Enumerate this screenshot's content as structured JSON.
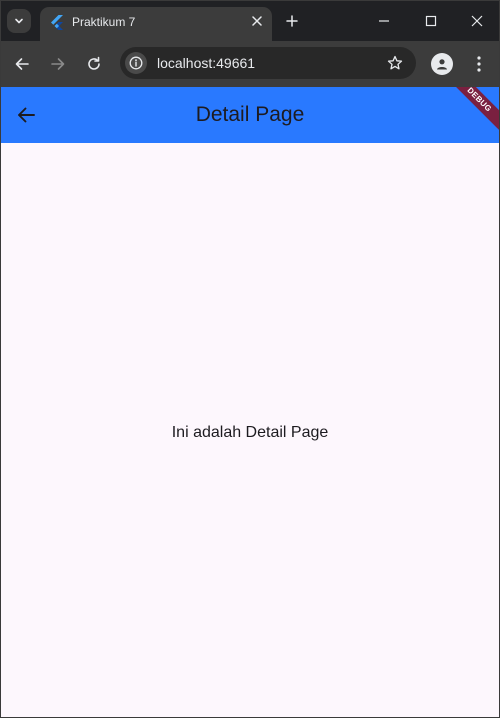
{
  "browser": {
    "tab": {
      "title": "Praktikum 7",
      "favicon": "flutter-icon"
    },
    "address": {
      "url": "localhost:49661"
    },
    "icons": {
      "tab_list": "chevron-down-icon",
      "close_tab": "close-icon",
      "new_tab": "plus-icon",
      "minimize": "minimize-icon",
      "maximize": "maximize-icon",
      "close_window": "close-icon",
      "back": "arrow-left-icon",
      "forward": "arrow-right-icon",
      "reload": "reload-icon",
      "site_info": "info-icon",
      "bookmark": "star-icon",
      "profile": "profile-icon",
      "menu": "more-vert-icon"
    }
  },
  "app": {
    "appbar": {
      "title": "Detail Page",
      "back_icon": "arrow-back-icon",
      "debug_banner": "DEBUG"
    },
    "body": {
      "text": "Ini adalah Detail Page"
    },
    "colors": {
      "appbar": "#2979ff",
      "background": "#fdf7fd",
      "debug_banner": "#7a2040"
    }
  }
}
